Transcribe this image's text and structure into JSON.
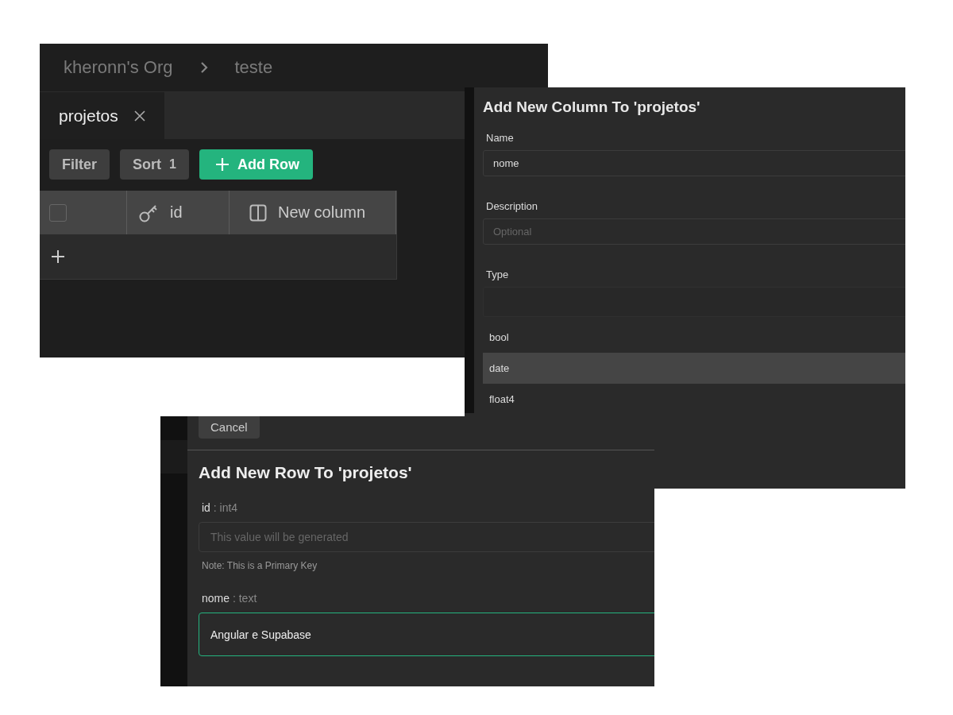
{
  "table_view": {
    "breadcrumb": [
      "kheronn's Org",
      "teste"
    ],
    "tabs": [
      {
        "label": "projetos",
        "selected": true
      }
    ],
    "toolbar": {
      "filter": "Filter",
      "sort": {
        "label": "Sort",
        "count": "1"
      },
      "add_row": "Add Row"
    },
    "columns": [
      {
        "kind": "select",
        "checked": false
      },
      {
        "kind": "key",
        "label": "id"
      },
      {
        "kind": "new",
        "label": "New column"
      }
    ]
  },
  "column_panel": {
    "title": "Add New Column To 'projetos'",
    "fields": [
      {
        "label": "Name",
        "value": "nome"
      },
      {
        "label": "Description",
        "placeholder": "Optional"
      },
      {
        "label": "Type"
      }
    ],
    "type_options": [
      {
        "label": "bool",
        "selected": false
      },
      {
        "label": "date",
        "selected": true
      },
      {
        "label": "float4",
        "selected": false
      }
    ]
  },
  "row_panel": {
    "cancel": "Cancel",
    "title": "Add New Row To 'projetos'",
    "fields": [
      {
        "name": "id",
        "type_hint": ": int4",
        "placeholder": "This value will be generated",
        "note": "Note: This is a Primary Key",
        "focused": false
      },
      {
        "name": "nome",
        "type_hint": ": text",
        "value": "Angular e Supabase",
        "focused": true
      }
    ]
  }
}
